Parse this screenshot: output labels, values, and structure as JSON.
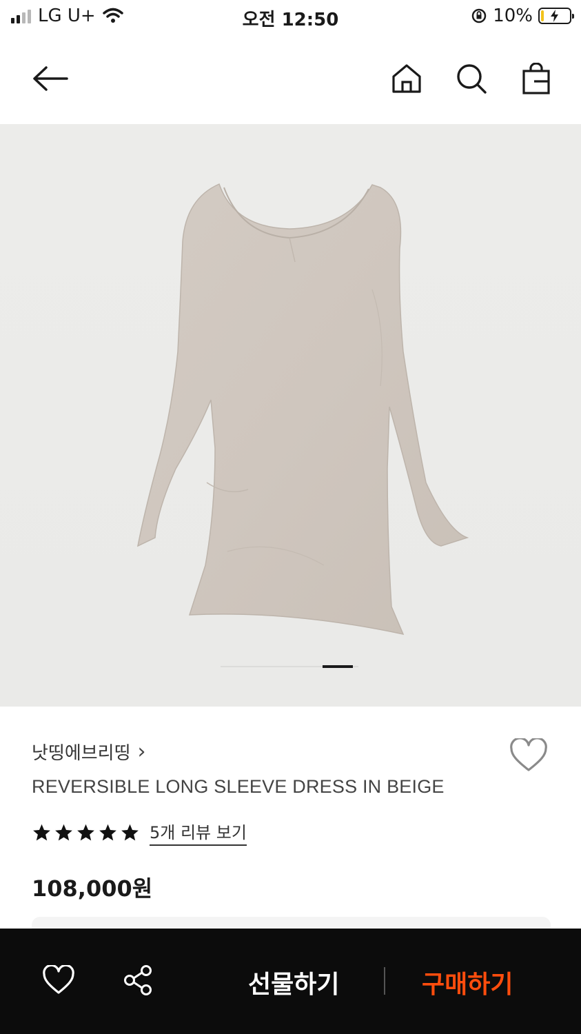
{
  "status_bar": {
    "carrier": "LG U+",
    "time": "오전 12:50",
    "battery": "10%",
    "battery_level": 0.1
  },
  "nav": {
    "icons": [
      "back-arrow-icon",
      "home-icon",
      "search-icon",
      "shopping-bag-icon"
    ]
  },
  "product": {
    "brand": "낫띵에브리띵",
    "brand_chevron": "›",
    "name": "REVERSIBLE LONG SLEEVE DRESS IN BEIGE",
    "rating": 5,
    "review_link": "5개 리뷰 보기",
    "price": "108,000원",
    "image_color": "#cfc6be",
    "carousel_total": 1,
    "carousel_active": 1
  },
  "bottom_bar": {
    "gift_label": "선물하기",
    "buy_label": "구매하기",
    "buy_color": "#ff4d0d",
    "icons": [
      "heart-icon",
      "share-icon"
    ]
  }
}
